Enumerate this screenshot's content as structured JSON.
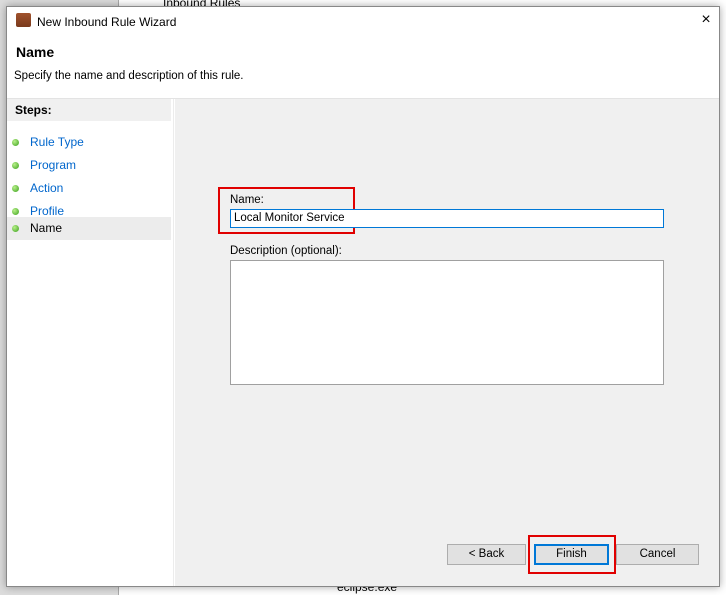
{
  "background": {
    "top_label": "Inbound Rules",
    "bottom_label": "eclipse.exe"
  },
  "dialog": {
    "title": "New Inbound Rule Wizard",
    "close_icon": "×",
    "heading": "Name",
    "subtitle": "Specify the name and description of this rule.",
    "steps_label": "Steps:",
    "steps": [
      {
        "label": "Rule Type"
      },
      {
        "label": "Program"
      },
      {
        "label": "Action"
      },
      {
        "label": "Profile"
      },
      {
        "label": "Name",
        "current": true
      }
    ],
    "name_label": "Name:",
    "name_value": "Local Monitor Service",
    "description_label": "Description (optional):",
    "description_value": "",
    "back_label": "< Back",
    "finish_label": "Finish",
    "cancel_label": "Cancel"
  }
}
